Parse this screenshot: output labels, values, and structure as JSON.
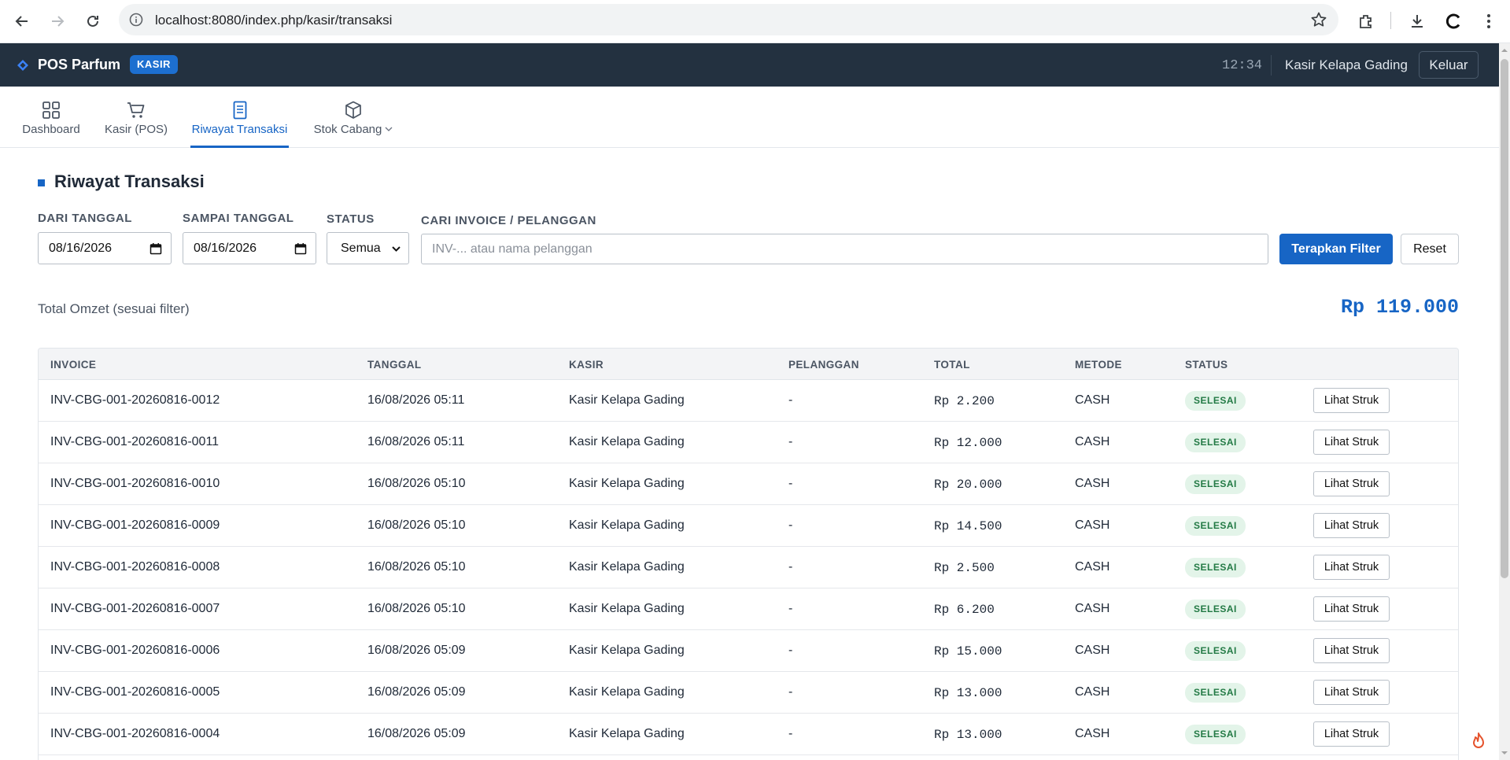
{
  "browser": {
    "url": "localhost:8080/index.php/kasir/transaksi"
  },
  "header": {
    "brand": "POS Parfum",
    "role_badge": "KASIR",
    "clock": "12:34",
    "user": "Kasir Kelapa Gading",
    "logout_label": "Keluar"
  },
  "tabs": [
    {
      "label": "Dashboard",
      "icon": "grid-icon",
      "active": false
    },
    {
      "label": "Kasir (POS)",
      "icon": "cart-icon",
      "active": false
    },
    {
      "label": "Riwayat Transaksi",
      "icon": "receipt-icon",
      "active": true
    },
    {
      "label": "Stok Cabang",
      "icon": "box-icon",
      "active": false
    }
  ],
  "page": {
    "title": "Riwayat Transaksi"
  },
  "filters": {
    "from_label": "DARI TANGGAL",
    "from_value": "08/16/2026",
    "to_label": "SAMPAI TANGGAL",
    "to_value": "08/16/2026",
    "status_label": "STATUS",
    "status_value": "Semua",
    "search_label": "CARI INVOICE / PELANGGAN",
    "search_placeholder": "INV-... atau nama pelanggan",
    "apply_label": "Terapkan Filter",
    "reset_label": "Reset"
  },
  "summary": {
    "label": "Total Omzet (sesuai filter)",
    "value": "Rp 119.000"
  },
  "table": {
    "columns": [
      "INVOICE",
      "TANGGAL",
      "KASIR",
      "PELANGGAN",
      "TOTAL",
      "METODE",
      "STATUS"
    ],
    "action_label": "Lihat Struk",
    "rows": [
      {
        "invoice": "INV-CBG-001-20260816-0012",
        "tanggal": "16/08/2026 05:11",
        "kasir": "Kasir Kelapa Gading",
        "pelanggan": "-",
        "total": "Rp 2.200",
        "metode": "CASH",
        "status": "SELESAI"
      },
      {
        "invoice": "INV-CBG-001-20260816-0011",
        "tanggal": "16/08/2026 05:11",
        "kasir": "Kasir Kelapa Gading",
        "pelanggan": "-",
        "total": "Rp 12.000",
        "metode": "CASH",
        "status": "SELESAI"
      },
      {
        "invoice": "INV-CBG-001-20260816-0010",
        "tanggal": "16/08/2026 05:10",
        "kasir": "Kasir Kelapa Gading",
        "pelanggan": "-",
        "total": "Rp 20.000",
        "metode": "CASH",
        "status": "SELESAI"
      },
      {
        "invoice": "INV-CBG-001-20260816-0009",
        "tanggal": "16/08/2026 05:10",
        "kasir": "Kasir Kelapa Gading",
        "pelanggan": "-",
        "total": "Rp 14.500",
        "metode": "CASH",
        "status": "SELESAI"
      },
      {
        "invoice": "INV-CBG-001-20260816-0008",
        "tanggal": "16/08/2026 05:10",
        "kasir": "Kasir Kelapa Gading",
        "pelanggan": "-",
        "total": "Rp 2.500",
        "metode": "CASH",
        "status": "SELESAI"
      },
      {
        "invoice": "INV-CBG-001-20260816-0007",
        "tanggal": "16/08/2026 05:10",
        "kasir": "Kasir Kelapa Gading",
        "pelanggan": "-",
        "total": "Rp 6.200",
        "metode": "CASH",
        "status": "SELESAI"
      },
      {
        "invoice": "INV-CBG-001-20260816-0006",
        "tanggal": "16/08/2026 05:09",
        "kasir": "Kasir Kelapa Gading",
        "pelanggan": "-",
        "total": "Rp 15.000",
        "metode": "CASH",
        "status": "SELESAI"
      },
      {
        "invoice": "INV-CBG-001-20260816-0005",
        "tanggal": "16/08/2026 05:09",
        "kasir": "Kasir Kelapa Gading",
        "pelanggan": "-",
        "total": "Rp 13.000",
        "metode": "CASH",
        "status": "SELESAI"
      },
      {
        "invoice": "INV-CBG-001-20260816-0004",
        "tanggal": "16/08/2026 05:09",
        "kasir": "Kasir Kelapa Gading",
        "pelanggan": "-",
        "total": "Rp 13.000",
        "metode": "CASH",
        "status": "SELESAI"
      }
    ]
  },
  "colors": {
    "header_bg": "#233140",
    "accent": "#1765c5",
    "status_ok_bg": "#e3f4e9",
    "status_ok_text": "#237a45"
  }
}
